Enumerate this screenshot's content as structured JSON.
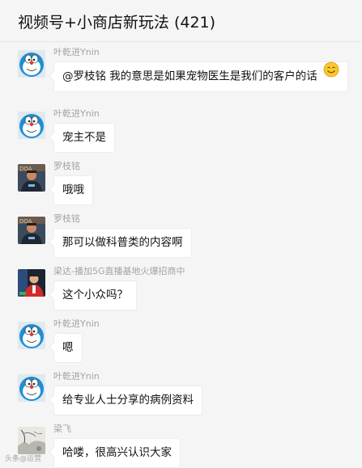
{
  "chat": {
    "title": "视频号+小商店新玩法 (421)"
  },
  "messages": [
    {
      "sender": "叶乾进Ynin",
      "avatar": "doraemon-avatar",
      "text": "@罗枝铭 我的意思是如果宠物医生是我们的客户的话"
    },
    {
      "sender": "叶乾进Ynin",
      "avatar": "doraemon-avatar",
      "text": "宠主不是"
    },
    {
      "sender": "罗枝铭",
      "avatar": "man-photo-avatar",
      "text": "哦哦"
    },
    {
      "sender": "罗枝铭",
      "avatar": "man-photo-avatar",
      "text": "那可以做科普类的内容啊"
    },
    {
      "sender": "梁达-播加5G直播基地火爆招商中",
      "avatar": "red-suit-avatar",
      "text": "这个小众吗？"
    },
    {
      "sender": "叶乾进Ynin",
      "avatar": "doraemon-avatar",
      "text": "嗯"
    },
    {
      "sender": "叶乾进Ynin",
      "avatar": "doraemon-avatar",
      "text": "给专业人士分享的病例资料"
    },
    {
      "sender": "梁飞",
      "avatar": "ink-painting-avatar",
      "text": "哈喽，很高兴认识大家"
    }
  ],
  "watermark": "头条@运营",
  "emoji": "smile-emoji"
}
